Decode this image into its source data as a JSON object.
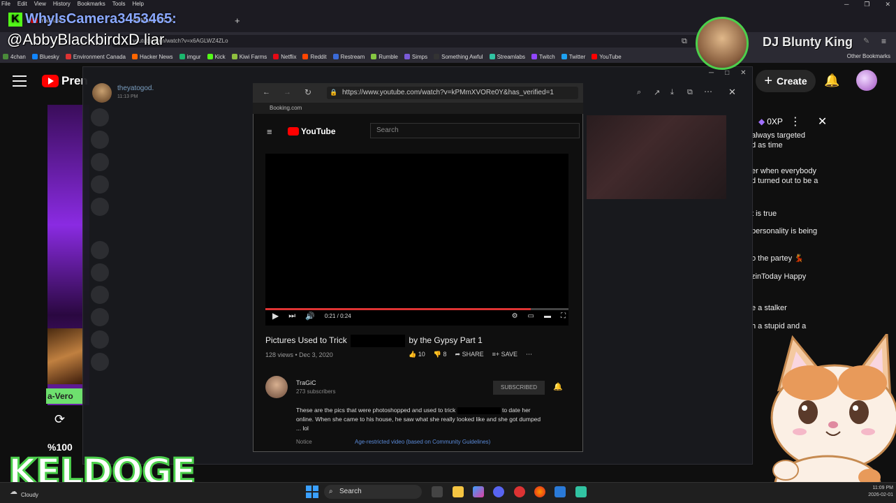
{
  "menubar": {
    "items": [
      "File",
      "Edit",
      "View",
      "History",
      "Bookmarks",
      "Tools",
      "Help"
    ]
  },
  "tabs": [
    {
      "label": "YouTube"
    },
    {
      "label": "Sit Marks & T"
    }
  ],
  "urlbar": {
    "url": "youtube.com/watch?v=x6AGLWZ4ZLo"
  },
  "bookmarks": [
    {
      "label": "4chan",
      "color": "#4a8a3a"
    },
    {
      "label": "Bluesky",
      "color": "#1185fe"
    },
    {
      "label": "Environment Canada",
      "color": "#d33"
    },
    {
      "label": "Hacker News",
      "color": "#ff6600"
    },
    {
      "label": "imgur",
      "color": "#1bb76e"
    },
    {
      "label": "Kick",
      "color": "#53fc18"
    },
    {
      "label": "Kiwi Farms",
      "color": "#8fbf3f"
    },
    {
      "label": "Netflix",
      "color": "#e50914"
    },
    {
      "label": "Reddit",
      "color": "#ff4500"
    },
    {
      "label": "Restream",
      "color": "#3a6ad8"
    },
    {
      "label": "Rumble",
      "color": "#85c742"
    },
    {
      "label": "Simps",
      "color": "#7a5ad8"
    },
    {
      "label": "Something Awful",
      "color": "#333"
    },
    {
      "label": "Streamlabs",
      "color": "#31c3a2"
    },
    {
      "label": "Twitch",
      "color": "#9146ff"
    },
    {
      "label": "Twitter",
      "color": "#1da1f2"
    },
    {
      "label": "YouTube",
      "color": "#ff0000"
    }
  ],
  "other_bookmarks": "Other Bookmarks",
  "youtube": {
    "logo_text": "Pren",
    "create_label": "Create"
  },
  "left_column": {
    "banner_text": "a-Vero",
    "percent": "%100"
  },
  "chat": {
    "xp": "0XP",
    "lines": [
      "always targeted",
      "d as time",
      "er when everybody",
      "d turned out to be a",
      "t is true",
      "personality is being",
      "o the partey 💃",
      "zinToday Happy",
      "e a stalker",
      "h a stupid and a"
    ]
  },
  "discord": {
    "username": "theyatogod.",
    "timestamp": "11:13 PM"
  },
  "share": {
    "url": "https://www.youtube.com/watch?v=kPMmXVORe0Y&has_verified=1",
    "bookmark": "Booking.com",
    "logo": "YouTube",
    "search_placeholder": "Search",
    "time": "0:21 / 0:24",
    "title_part1": "Pictures Used to Trick",
    "title_part2": "by the Gypsy Part 1",
    "meta": "128 views • Dec 3, 2020",
    "likes": "10",
    "dislikes": "8",
    "share_label": "SHARE",
    "save_label": "SAVE",
    "channel_name": "TraGiC",
    "channel_subs": "273 subscribers",
    "subscribed_label": "SUBSCRIBED",
    "description_line1a": "These are the pics that were photoshopped and used to trick",
    "description_line1b": "to date her",
    "description_line2": "online. When she came to his house, he saw what she really looked like and she got dumped",
    "description_line3": "... lol",
    "notice_label": "Notice",
    "age_restricted": "Age-restricted video (based on Community Guidelines)"
  },
  "overlay": {
    "top_line1": "WhyIsCamera3453465:",
    "top_line2": "@AbbyBlackbirdxD liar",
    "dj_name": "DJ Blunty King",
    "streamer_name": "KELDOGE"
  },
  "taskbar": {
    "weather": "Cloudy",
    "search_label": "Search",
    "time": "11:09 PM",
    "date": "2026-02-01"
  }
}
